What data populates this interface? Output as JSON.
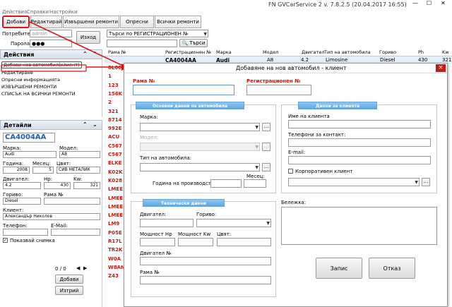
{
  "window": {
    "title": "FN GVCarService 2 v. 7.8.2.5 (20.04.2017 16:55)"
  },
  "menu": {
    "items": [
      "Действия",
      "Справки",
      "Настройки"
    ]
  },
  "tabs": [
    "Добави",
    "Редактирай",
    "Извършени ремонти",
    "Опресни",
    "Всички ремонти"
  ],
  "login": {
    "user_label": "Потребител:",
    "user_value": "admin",
    "pass_label": "Парола:",
    "pass_value": "●●●",
    "exit": "Изход"
  },
  "search": {
    "combo": "Търси по РЕГИСТРАЦИОНЕН №",
    "button": "Търси"
  },
  "actions": {
    "title": "Действия",
    "items": [
      "Добави нов автомобил(клиент)",
      "Редактиране",
      "Опресни информацията",
      "ИЗВЪРШЕНИ РЕМОНТИ",
      "СПИСЪК НА ВСИЧКИ РЕМОНТИ"
    ]
  },
  "details": {
    "title": "Детайли",
    "reg": "CA4004AA",
    "make_label": "Марка:",
    "make": "Audi",
    "model_label": "Модел:",
    "model": "A8",
    "year_label": "Година:",
    "year": "2008",
    "month_label": "Месец:",
    "month": "5",
    "color_label": "Цвят:",
    "color": "СИВ МЕТАЛИК",
    "engine_label": "Двигател:",
    "engine": "4.2",
    "hp_label": "Hp:",
    "hp": "430",
    "kw_label": "Kw:",
    "kw": "321",
    "fuel_label": "Гориво:",
    "fuel": "Diesel",
    "vin_label": "Рама №",
    "client_label": "Клиент:",
    "client": "Александър Николов",
    "phone_label": "Телефон:",
    "email_label": "E-Mail:",
    "show_photo": "Показвай снимка",
    "counter": "0 / 0",
    "add": "Добави",
    "delete": "Изтрий"
  },
  "grid": {
    "columns": [
      "Рама №",
      "Регистрационен №",
      "Марка",
      "Модел",
      "Двигател",
      "Тип на автомобила",
      "Гориво",
      "Ph",
      "Kw"
    ],
    "first_row": [
      "",
      "CA4004AA",
      "Audi",
      "A8",
      "4.2",
      "Limosine",
      "Diesel",
      "430",
      "321"
    ],
    "partial_rows": [
      "0L00",
      "1",
      "123",
      "156K",
      "2",
      "321",
      "8714",
      "992E",
      "ACU",
      "C567",
      "C567",
      "ELKE",
      "K02K",
      "K028",
      "LMEE",
      "LMEE",
      "LMEE",
      "LMEE",
      "LM9",
      "P05E",
      "R17L",
      "TR2K",
      "W0A",
      "W8AN",
      "Z43"
    ]
  },
  "dialog": {
    "title": "Добавяне на нов автомобил - клиент",
    "vin_label": "Рама №",
    "reg_label": "Регистрационен №",
    "main_group": "Основни данни на автомобила",
    "make_label": "Марка:",
    "model_label": "Модел:",
    "type_label": "Тип на автомобила:",
    "year_label": "Година на производство:",
    "month_label": "Месец:",
    "client_group": "Данни за клиента",
    "client_name_label": "Име на клиента",
    "phone_label": "Телефони за контакт:",
    "email_label": "E-mail:",
    "corporate_label": "Корпоративен клиент",
    "tech_group": "Технически данни",
    "engine_label": "Двигател:",
    "fuel_label": "Гориво:",
    "hp_label": "Мощност Hp",
    "kw_label": "Мощност Kw",
    "color_label": "Цвят:",
    "engine_no_label": "Двигател №",
    "vin2_label": "Рама №",
    "note_label": "Бележка:",
    "save": "Запис",
    "cancel": "Отказ",
    "close": "×"
  }
}
